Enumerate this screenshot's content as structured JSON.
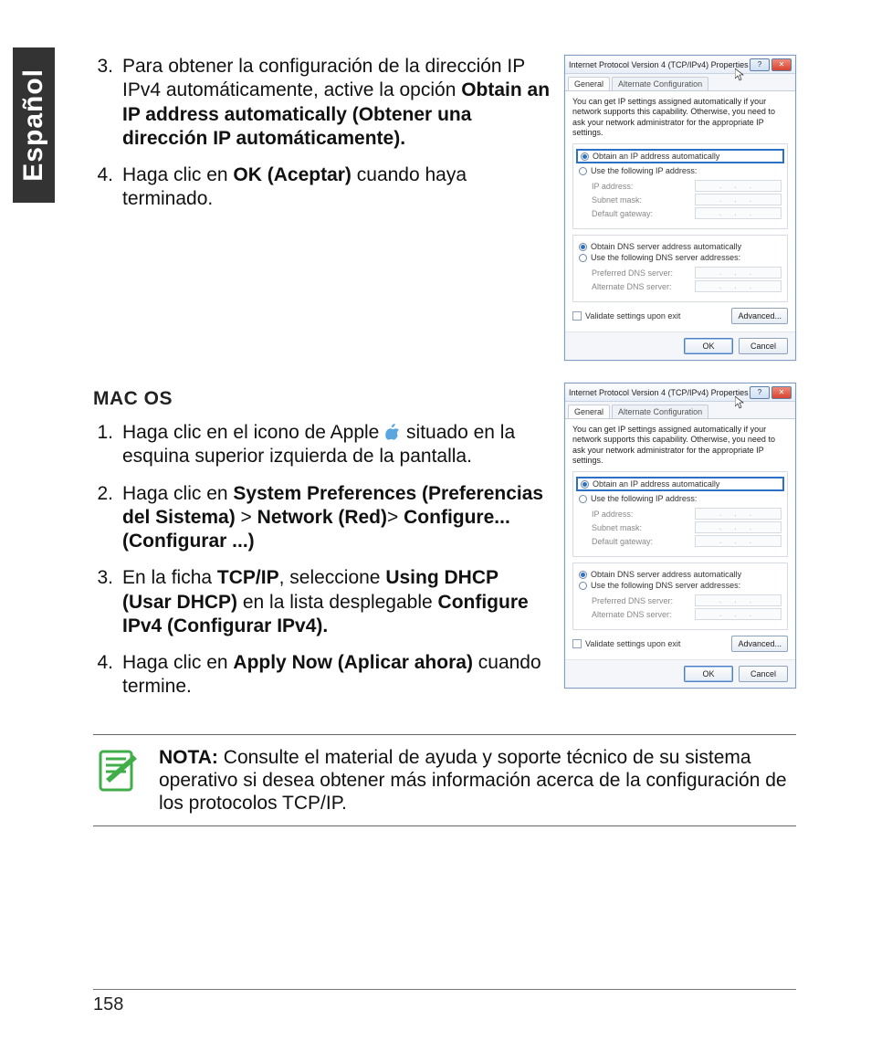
{
  "language_tab": "Español",
  "page_number": "158",
  "section1": {
    "items": [
      {
        "num": "3.",
        "pre": "Para obtener la configuración de la dirección IP IPv4 automáticamente, active la opción ",
        "bold": "Obtain an IP address automatically (Obtener una dirección IP automáticamente).",
        "post": ""
      },
      {
        "num": "4.",
        "pre": "Haga clic en ",
        "bold": "OK (Aceptar)",
        "post": " cuando haya terminado."
      }
    ]
  },
  "macos_heading": "MAC OS",
  "section2": {
    "items": [
      {
        "num": "1.",
        "parts": [
          {
            "t": "Haga clic en el icono de Apple "
          },
          {
            "icon": true
          },
          {
            "t": " situado en la esquina superior izquierda de la pantalla."
          }
        ]
      },
      {
        "num": "2.",
        "parts": [
          {
            "t": "Haga clic en "
          },
          {
            "b": "System Preferences (Preferencias del Sistema)"
          },
          {
            "t": " > "
          },
          {
            "b": "Network (Red)"
          },
          {
            "t": "> "
          },
          {
            "b": "Configure... (Configurar ...)"
          }
        ]
      },
      {
        "num": "3.",
        "parts": [
          {
            "t": "En la ficha "
          },
          {
            "b": "TCP/IP"
          },
          {
            "t": ", seleccione "
          },
          {
            "b": "Using DHCP (Usar DHCP)"
          },
          {
            "t": " en la lista desplegable "
          },
          {
            "b": "Configure IPv4 (Configurar IPv4)."
          }
        ]
      },
      {
        "num": "4.",
        "parts": [
          {
            "t": "Haga clic en "
          },
          {
            "b": "Apply Now (Aplicar ahora)"
          },
          {
            "t": " cuando termine."
          }
        ]
      }
    ]
  },
  "note": {
    "label": "NOTA:",
    "text": " Consulte el material de ayuda y soporte técnico de su sistema operativo si desea obtener más información acerca de la configuración de los protocolos TCP/IP."
  },
  "dialog": {
    "title": "Internet Protocol Version 4 (TCP/IPv4) Properties",
    "help": "?",
    "close": "✕",
    "tabs": [
      "General",
      "Alternate Configuration"
    ],
    "intro": "You can get IP settings assigned automatically if your network supports this capability. Otherwise, you need to ask your network administrator for the appropriate IP settings.",
    "opts": {
      "auto_ip": "Obtain an IP address automatically",
      "man_ip": "Use the following IP address:",
      "ip": "IP address:",
      "mask": "Subnet mask:",
      "gw": "Default gateway:",
      "auto_dns": "Obtain DNS server address automatically",
      "man_dns": "Use the following DNS server addresses:",
      "pdns": "Preferred DNS server:",
      "adns": "Alternate DNS server:",
      "validate": "Validate settings upon exit",
      "dots": ".   .   ."
    },
    "buttons": {
      "adv": "Advanced...",
      "ok": "OK",
      "cancel": "Cancel"
    }
  }
}
